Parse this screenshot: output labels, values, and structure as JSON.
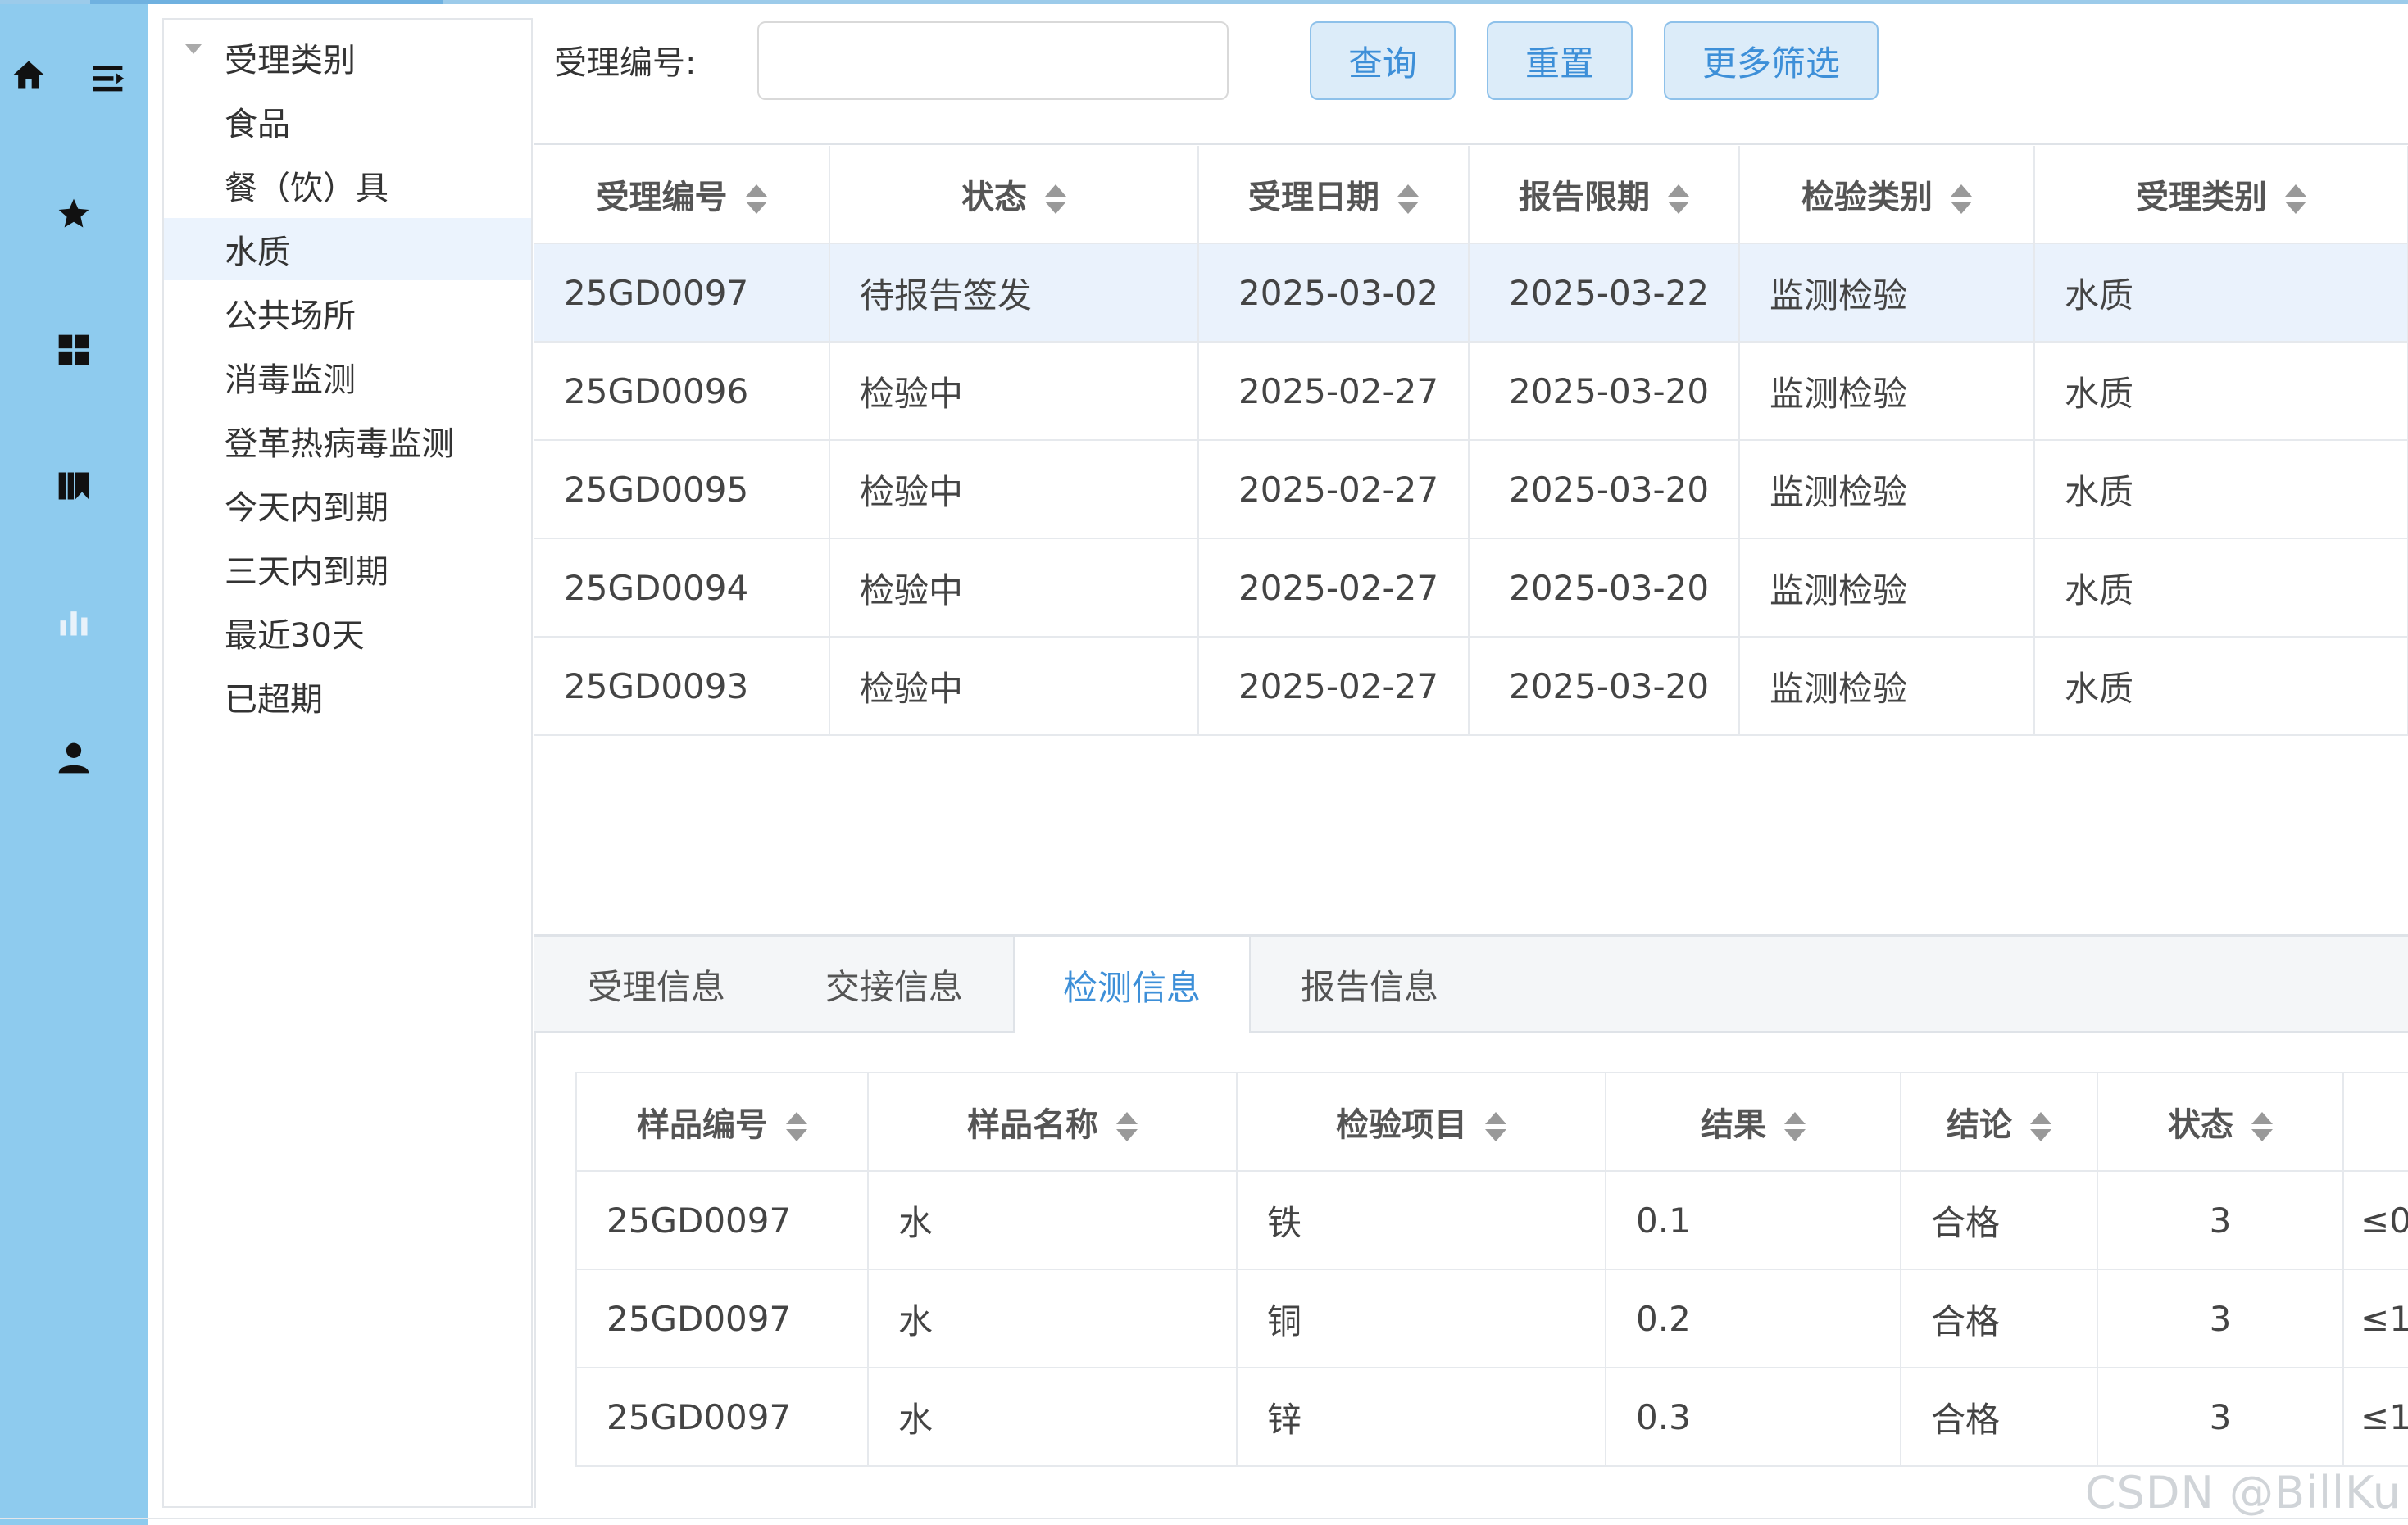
{
  "rail": {
    "icons": [
      "home-icon",
      "menu-toggle-icon",
      "star-icon",
      "grid-icon",
      "library-icon",
      "bar-chart-icon",
      "user-icon"
    ]
  },
  "tree": {
    "root_label": "受理类别",
    "items": [
      {
        "label": "食品",
        "selected": false
      },
      {
        "label": "餐（饮）具",
        "selected": false
      },
      {
        "label": "水质",
        "selected": true
      },
      {
        "label": "公共场所",
        "selected": false
      },
      {
        "label": "消毒监测",
        "selected": false
      },
      {
        "label": "登革热病毒监测",
        "selected": false
      },
      {
        "label": "今天内到期",
        "selected": false
      },
      {
        "label": "三天内到期",
        "selected": false
      },
      {
        "label": "最近30天",
        "selected": false
      },
      {
        "label": "已超期",
        "selected": false
      }
    ]
  },
  "search": {
    "label": "受理编号:",
    "value": "",
    "placeholder": "",
    "query_label": "查询",
    "reset_label": "重置",
    "more_label": "更多筛选"
  },
  "main_table": {
    "columns": [
      "受理编号",
      "状态",
      "受理日期",
      "报告限期",
      "检验类别",
      "受理类别"
    ],
    "rows": [
      [
        "25GD0097",
        "待报告签发",
        "2025-03-02",
        "2025-03-22",
        "监测检验",
        "水质"
      ],
      [
        "25GD0096",
        "检验中",
        "2025-02-27",
        "2025-03-20",
        "监测检验",
        "水质"
      ],
      [
        "25GD0095",
        "检验中",
        "2025-02-27",
        "2025-03-20",
        "监测检验",
        "水质"
      ],
      [
        "25GD0094",
        "检验中",
        "2025-02-27",
        "2025-03-20",
        "监测检验",
        "水质"
      ],
      [
        "25GD0093",
        "检验中",
        "2025-02-27",
        "2025-03-20",
        "监测检验",
        "水质"
      ]
    ],
    "selected_row": 0
  },
  "tabs": [
    "受理信息",
    "交接信息",
    "检测信息",
    "报告信息"
  ],
  "active_tab": 2,
  "detail_table": {
    "columns": [
      "样品编号",
      "样品名称",
      "检验项目",
      "结果",
      "结论",
      "状态"
    ],
    "rows": [
      [
        "25GD0097",
        "水",
        "铁",
        "0.1",
        "合格",
        "3",
        "≤0"
      ],
      [
        "25GD0097",
        "水",
        "铜",
        "0.2",
        "合格",
        "3",
        "≤1"
      ],
      [
        "25GD0097",
        "水",
        "锌",
        "0.3",
        "合格",
        "3",
        "≤1"
      ]
    ]
  },
  "watermark": "CSDN @BillKu",
  "colors": {
    "rail": "#8ecbee",
    "accent": "#3d8fd8",
    "button_bg": "#dcecf9",
    "selected_row": "#eaf2fc"
  }
}
